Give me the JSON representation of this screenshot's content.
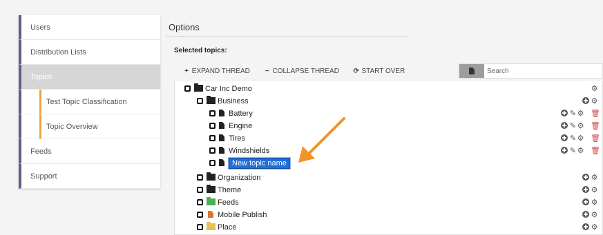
{
  "sidebar": {
    "items": [
      {
        "label": "Users"
      },
      {
        "label": "Distribution Lists"
      },
      {
        "label": "Topics"
      },
      {
        "label": "Test Topic Classification"
      },
      {
        "label": "Topic Overview"
      },
      {
        "label": "Feeds"
      },
      {
        "label": "Support"
      }
    ]
  },
  "main": {
    "title": "Options",
    "selected_label": "Selected topics:",
    "toolbar": {
      "expand": "EXPAND THREAD",
      "collapse": "COLLAPSE THREAD",
      "start_over": "START OVER",
      "expand_icon": "+",
      "collapse_icon": "−",
      "start_over_icon": "⟳"
    },
    "search": {
      "placeholder": "Search"
    }
  },
  "tree": {
    "root": "Car Inc Demo",
    "business": "Business",
    "children": [
      "Battery",
      "Engine",
      "Tires",
      "Windshields"
    ],
    "new_topic": "New topic name",
    "others": [
      "Organization",
      "Theme",
      "Feeds",
      "Mobile Publish",
      "Place"
    ]
  },
  "icons": {
    "gear": "⚙",
    "wrench": "✎",
    "trash": "🗑"
  },
  "colors": {
    "accent": "#6a5a8a",
    "sub_accent": "#f2a33a",
    "selection": "#1e6fd9",
    "arrow": "#f0952a",
    "folder_dark": "#222222",
    "folder_green": "#4caf50",
    "folder_orange": "#d4782b",
    "folder_yellow": "#e6c15a",
    "trash": "#d24a4a"
  }
}
